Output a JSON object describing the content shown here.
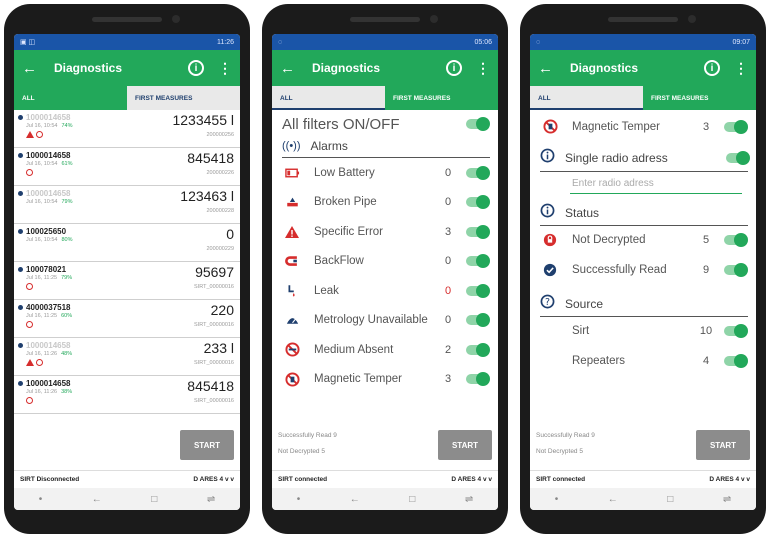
{
  "common": {
    "title": "Diagnostics",
    "tab_all": "ALL",
    "tab_first": "FIRST MEASURES",
    "start": "START"
  },
  "phone1": {
    "status_time": "11:26",
    "rows": [
      {
        "serial": "1000014658",
        "date": "Jul 16, 10:54",
        "pct": "74%",
        "value": "1233455 l",
        "sub": "200000256",
        "faded": true
      },
      {
        "serial": "1000014658",
        "date": "Jul 16, 10:54",
        "pct": "61%",
        "value": "845418",
        "sub": "200000226",
        "faded": false
      },
      {
        "serial": "1000014658",
        "date": "Jul 16, 10:54",
        "pct": "79%",
        "value": "123463 l",
        "sub": "200000228",
        "faded": true
      },
      {
        "serial": "100025650",
        "date": "Jul 16, 10:54",
        "pct": "80%",
        "value": "0",
        "sub": "200000229",
        "faded": false
      },
      {
        "serial": "100078021",
        "date": "Jul 16, 11:25",
        "pct": "79%",
        "value": "95697",
        "sub": "SIRT_00000016",
        "faded": false
      },
      {
        "serial": "4000037518",
        "date": "Jul 16, 11:25",
        "pct": "60%",
        "value": "220",
        "sub": "SIRT_00000016",
        "faded": false
      },
      {
        "serial": "1000014658",
        "date": "Jul 16, 11:26",
        "pct": "48%",
        "value": "233 l",
        "sub": "SIRT_00000016",
        "faded": true
      },
      {
        "serial": "1000014658",
        "date": "Jul 16, 11:26",
        "pct": "38%",
        "value": "845418",
        "sub": "SIRT_00000016",
        "faded": false
      }
    ],
    "sirt_status": "SIRT Disconnected",
    "area": "D ARES 4 v v"
  },
  "phone2": {
    "status_time": "05:06",
    "all_filters": "All filters ON/OFF",
    "alarms": "Alarms",
    "filters": [
      {
        "label": "Low Battery",
        "count": "0",
        "icon": "battery-icon"
      },
      {
        "label": "Broken Pipe",
        "count": "0",
        "icon": "broken-pipe-icon"
      },
      {
        "label": "Specific Error",
        "count": "3",
        "icon": "warning-icon"
      },
      {
        "label": "BackFlow",
        "count": "0",
        "icon": "backflow-icon"
      },
      {
        "label": "Leak",
        "count": "0",
        "icon": "leak-icon"
      },
      {
        "label": "Metrology Unavailable",
        "count": "0",
        "icon": "metrology-icon"
      },
      {
        "label": "Medium Absent",
        "count": "2",
        "icon": "no-medium-icon"
      },
      {
        "label": "Magnetic Temper",
        "count": "3",
        "icon": "magnet-icon"
      }
    ],
    "success_read": "Successfully Read  9",
    "not_decrypted": "Not Decrypted      5",
    "sirt_status": "SIRT connected",
    "area": "D ARES 4 v v"
  },
  "phone3": {
    "status_time": "09:07",
    "magnetic": {
      "label": "Magnetic Temper",
      "count": "3"
    },
    "single_radio": "Single radio adress",
    "radio_placeholder": "Enter radio adress",
    "status_header": "Status",
    "not_decrypted": {
      "label": "Not Decrypted",
      "count": "5"
    },
    "success": {
      "label": "Successfully Read",
      "count": "9"
    },
    "source_header": "Source",
    "sirt": {
      "label": "Sirt",
      "count": "10"
    },
    "repeaters": {
      "label": "Repeaters",
      "count": "4"
    },
    "success_read": "Successfully Read  9",
    "not_decrypted_summary": "Not Decrypted      5",
    "sirt_status": "SIRT connected",
    "area": "D ARES 4 v v"
  },
  "colors": {
    "green": "#22a85a",
    "navy": "#1f3f6e",
    "red": "#d62d2d",
    "status_blue": "#1a55a8"
  }
}
